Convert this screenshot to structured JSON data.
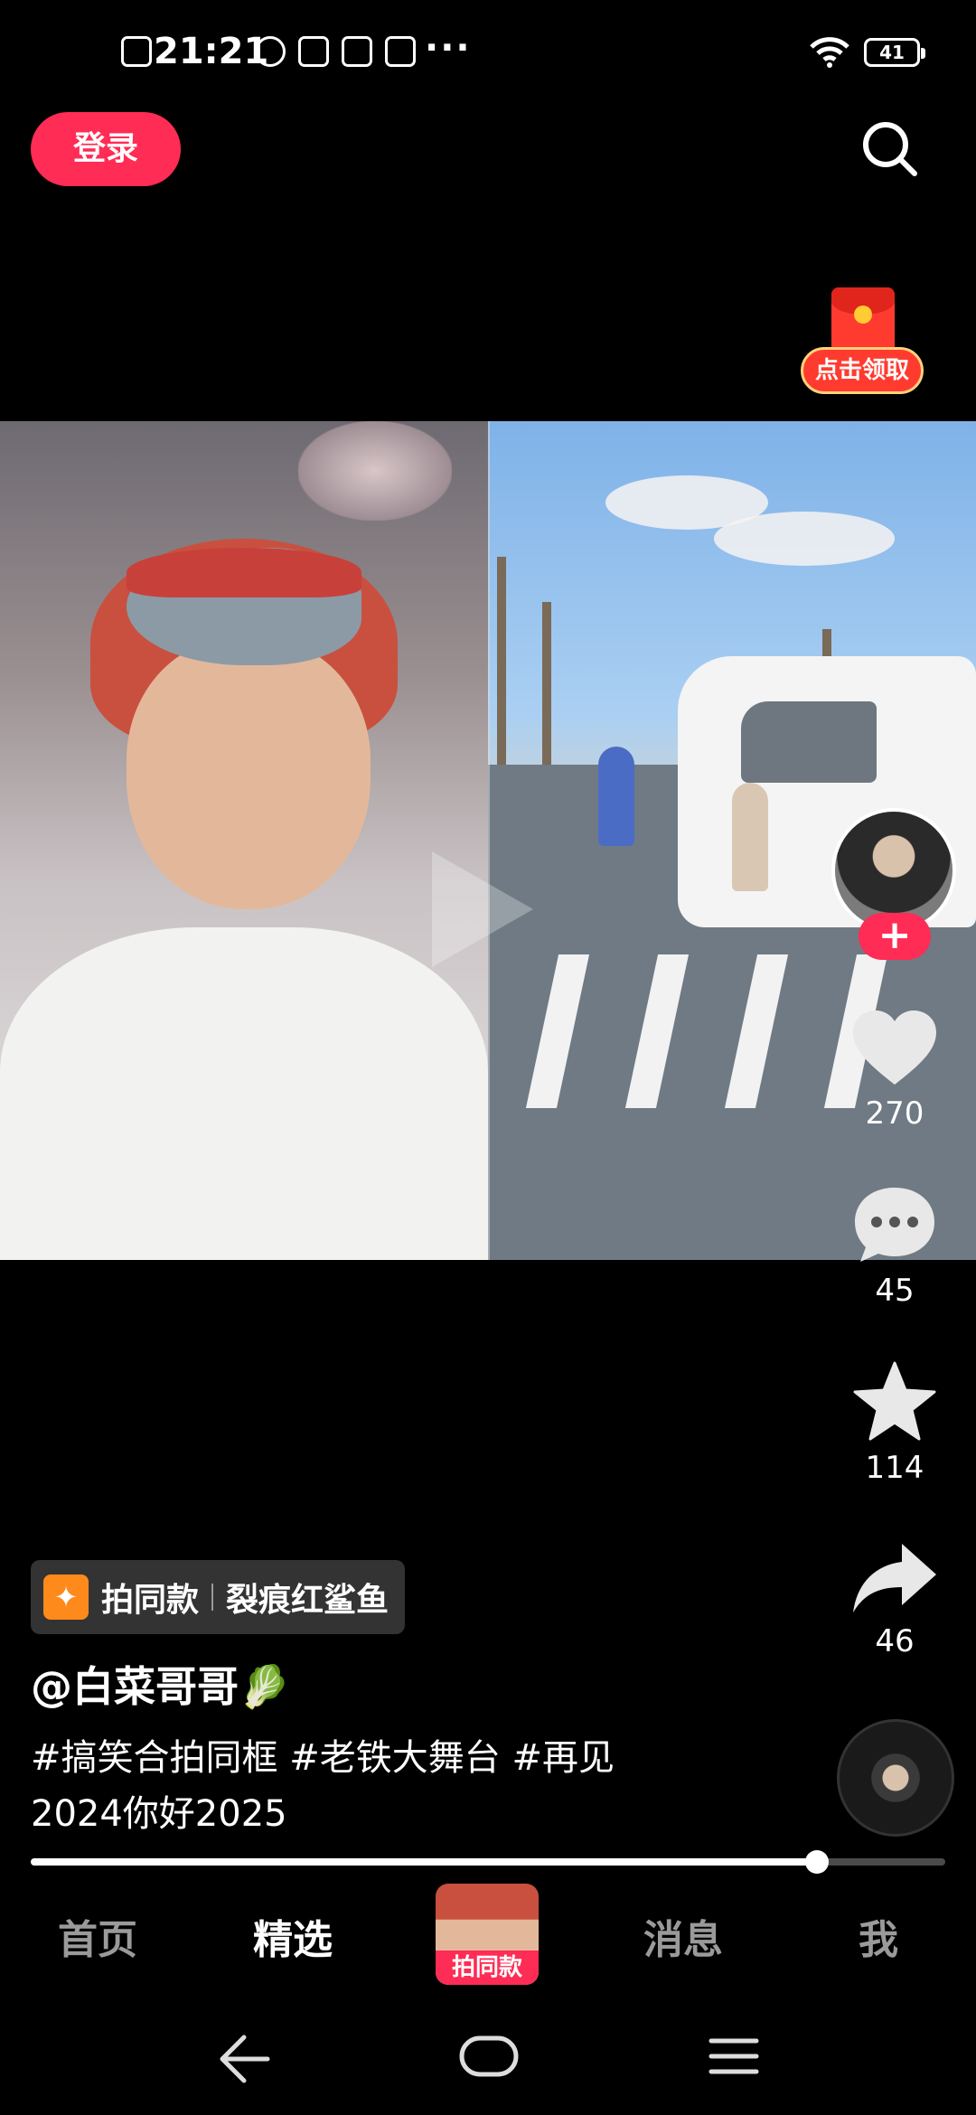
{
  "status_bar": {
    "time": "21:21",
    "overflow": "···",
    "battery": "41",
    "icons": [
      "sim-icon",
      "app-icon",
      "play-icon",
      "qq-icon",
      "video-icon",
      "wifi-icon",
      "battery-icon"
    ]
  },
  "top_bar": {
    "login_label": "登录",
    "search_icon": "search-icon"
  },
  "red_packet": {
    "label": "点击领取"
  },
  "actions": {
    "likes": "270",
    "comments": "45",
    "favorites": "114",
    "shares": "46",
    "follow_plus": "+"
  },
  "same_style": {
    "label": "拍同款",
    "effect": "裂痕红鲨鱼"
  },
  "post": {
    "author": "@白菜哥哥🥬",
    "caption_line1": "#搞笑合拍同框 #老铁大舞台 #再见",
    "caption_line2": "2024你好2025"
  },
  "playback": {
    "progress": 0.86
  },
  "tab_bar": {
    "home": "首页",
    "featured": "精选",
    "center": "拍同款",
    "messages": "消息",
    "me": "我"
  },
  "colors": {
    "accent": "#ff2c55",
    "background": "#000000"
  }
}
